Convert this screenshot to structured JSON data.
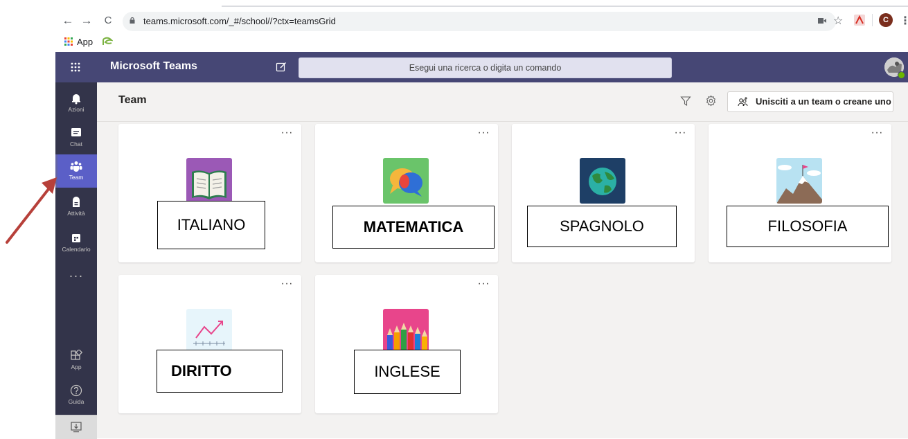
{
  "browser": {
    "back_label": "←",
    "forward_label": "→",
    "reload_label": "C",
    "url": "teams.microsoft.com/_#/school//?ctx=teamsGrid",
    "profile_initial": "C",
    "bookmarks": {
      "apps_label": "App"
    }
  },
  "teams": {
    "app_name": "Microsoft Teams",
    "search_placeholder": "Esegui una ricerca o digita un comando",
    "presence_color": "#6bb700",
    "brand_color": "#464775"
  },
  "rail": {
    "items": [
      {
        "label": "Azioni",
        "icon": "bell-icon"
      },
      {
        "label": "Chat",
        "icon": "chat-icon"
      },
      {
        "label": "Team",
        "icon": "teams-icon"
      },
      {
        "label": "Attività",
        "icon": "assignments-icon"
      },
      {
        "label": "Calendario",
        "icon": "calendar-icon"
      }
    ],
    "more_label": "···",
    "bottom": [
      {
        "label": "App",
        "icon": "apps-icon"
      },
      {
        "label": "Guida",
        "icon": "help-icon"
      }
    ]
  },
  "main": {
    "title": "Team",
    "join_label": "Unisciti a un team o creane uno",
    "more_label": "···",
    "cards": [
      {
        "label": "ITALIANO",
        "image": "book-icon",
        "color": "#9b59b6"
      },
      {
        "label": "MATEMATICA",
        "image": "speech-bubbles-icon",
        "color": "#6ac46a"
      },
      {
        "label": "SPAGNOLO",
        "image": "globe-icon",
        "color": "#1e3f66"
      },
      {
        "label": "FILOSOFIA",
        "image": "mountain-flag-icon",
        "color": "#b8e2f2"
      },
      {
        "label": "DIRITTO",
        "image": "trend-chart-icon",
        "color": "#e7f5fb"
      },
      {
        "label": "INGLESE",
        "image": "pencils-icon",
        "color": "#e8458b"
      }
    ]
  }
}
